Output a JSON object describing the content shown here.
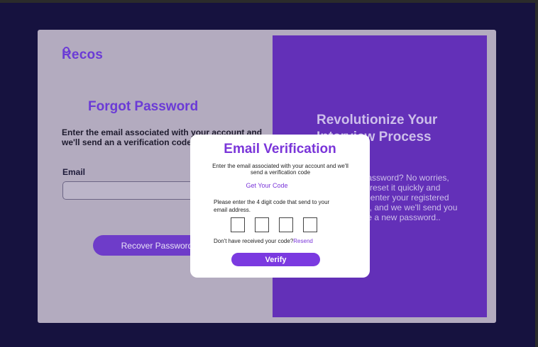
{
  "brand": {
    "name_initial": "R",
    "name_rest": "ecos"
  },
  "forgot": {
    "title": "Forgot Password",
    "description": "Enter the email associated with your account and we'll send an a verification code.",
    "email_label": "Email",
    "email_value": "",
    "recover_label": "Recover Password"
  },
  "promo": {
    "title": "Revolutionize Your Interview Process",
    "text": "Forgot your password? No worries, we'll help you reset it quickly and securely. Just enter your registered email address, and we we'll send you a link to create  a new password.."
  },
  "modal": {
    "title": "Email Verification",
    "description": "Enter the  email associated with your account and we'll send a verification code",
    "get_code_link": "Get Your Code",
    "prompt": "Please enter the 4 digit code that send to your email address.",
    "code_digits": [
      "",
      "",
      "",
      ""
    ],
    "resend_prefix": "Don't have received your code?",
    "resend_link": "Resend",
    "verify_label": "Verify"
  },
  "colors": {
    "background": "#16123f",
    "card": "#b3abbf",
    "accent": "#7a35d9",
    "panel": "#6330b8"
  }
}
